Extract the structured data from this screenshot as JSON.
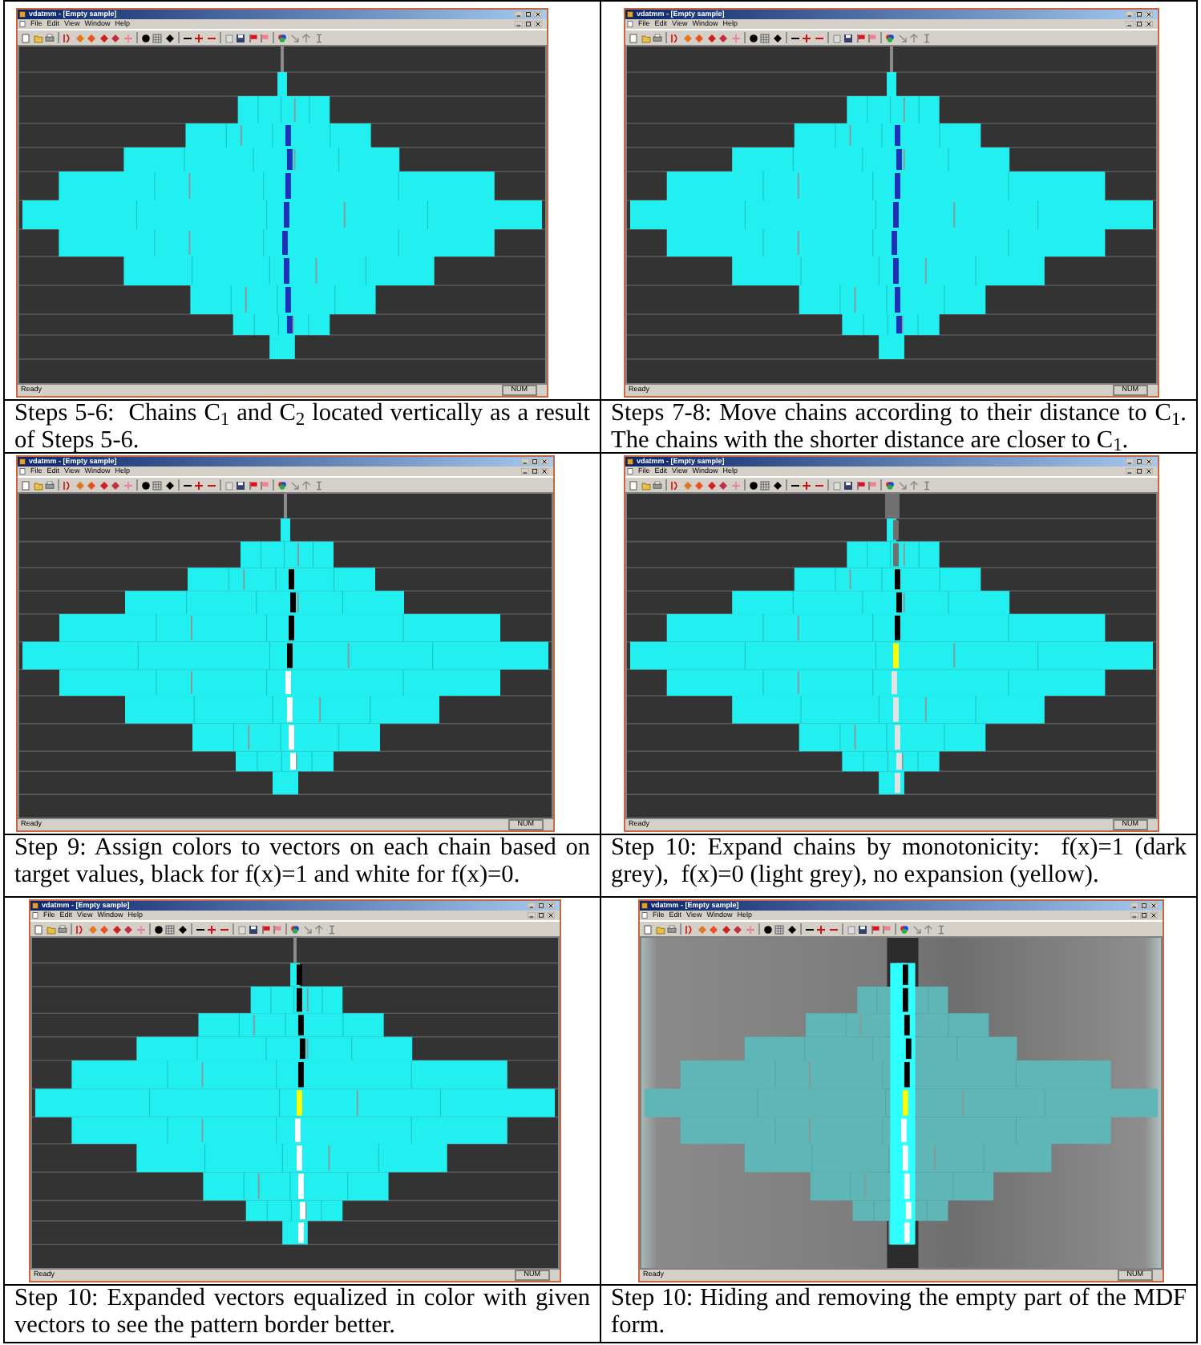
{
  "panels": [
    {
      "kind": "located",
      "window": {
        "title": "vdatmm - [Empty sample]",
        "menu": [
          "File",
          "Edit",
          "View",
          "Window",
          "Help"
        ],
        "status": "Ready",
        "indicator": "NUM"
      },
      "caption": "Steps 5-6:  Chains C$_{1}$ and C$_{2}$ located vertically as a result of Steps 5-6."
    },
    {
      "kind": "moved",
      "window": {
        "title": "vdatmm - [Empty sample]",
        "menu": [
          "File",
          "Edit",
          "View",
          "Window",
          "Help"
        ],
        "status": "Ready",
        "indicator": "NUM"
      },
      "caption": "Steps 7-8: Move chains according to their distance to C$_{1}$. The chains with the shorter distance are closer to C$_{1}$."
    },
    {
      "kind": "colored",
      "window": {
        "title": "vdatmm - [Empty sample]",
        "menu": [
          "File",
          "Edit",
          "View",
          "Window",
          "Help"
        ],
        "status": "Ready",
        "indicator": "NUM"
      },
      "caption": "Step 9: Assign colors to vectors on each chain based on target values, black for f(x)=1 and white for f(x)=0."
    },
    {
      "kind": "expanded",
      "window": {
        "title": "vdatmm - [Empty sample]",
        "menu": [
          "File",
          "Edit",
          "View",
          "Window",
          "Help"
        ],
        "status": "Ready",
        "indicator": "NUM"
      },
      "caption": "Step 10: Expand chains by monotonicity:  f(x)=1 (dark grey),  f(x)=0 (light grey), no expansion (yellow)."
    },
    {
      "kind": "equalized",
      "window": {
        "title": "vdatmm - [Empty sample]",
        "menu": [
          "File",
          "Edit",
          "View",
          "Window",
          "Help"
        ],
        "status": "Ready",
        "indicator": "NUM"
      },
      "caption": "Step 10: Expanded vectors equalized in color with given vectors to see the pattern border better."
    },
    {
      "kind": "hidden",
      "window": {
        "title": "vdatmm - [Empty sample]",
        "menu": [
          "File",
          "Edit",
          "View",
          "Window",
          "Help"
        ],
        "status": "Ready",
        "indicator": "NUM"
      },
      "caption": "Step 10: Hiding and removing the empty part of the MDF form."
    }
  ]
}
